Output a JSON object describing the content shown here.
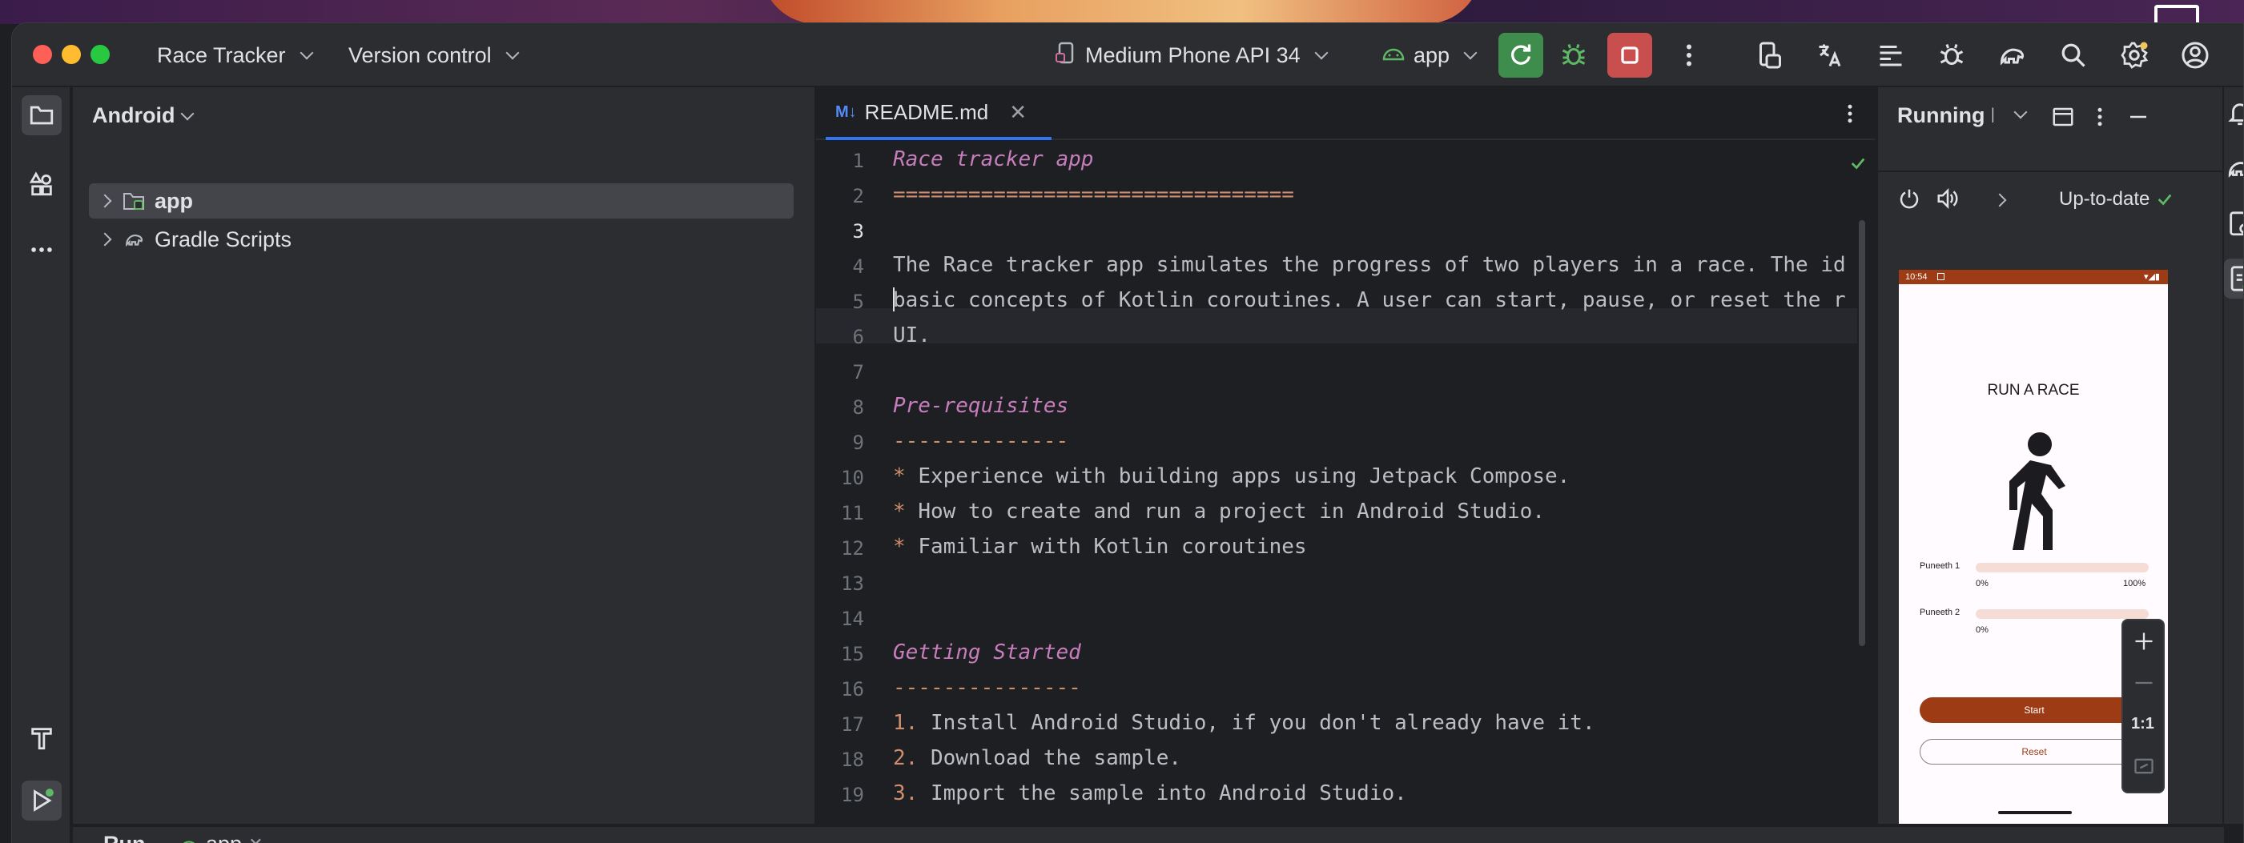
{
  "titlebar": {
    "project_name": "Race Tracker",
    "vcs": "Version control",
    "device": "Medium Phone API 34",
    "run_config": "app"
  },
  "project_panel": {
    "view_mode": "Android",
    "items": [
      {
        "label": "app",
        "selected": true
      },
      {
        "label": "Gradle Scripts",
        "selected": false
      }
    ]
  },
  "editor": {
    "tab_label": "README.md",
    "tab_icon": "M↓",
    "lines": [
      "Race tracker app",
      "================================",
      "",
      "The Race tracker app simulates the progress of two players in a race. The id",
      "basic concepts of Kotlin coroutines. A user can start, pause, or reset the r",
      "UI.",
      "",
      "Pre-requisites",
      "--------------",
      "* Experience with building apps using Jetpack Compose.",
      "* How to create and run a project in Android Studio.",
      "* Familiar with Kotlin coroutines",
      "",
      "",
      "Getting Started",
      "---------------",
      "1. Install Android Studio, if you don't already have it.",
      "2. Download the sample.",
      "3. Import the sample into Android Studio."
    ],
    "line_numbers": [
      "1",
      "2",
      "3",
      "4",
      "5",
      "6",
      "7",
      "8",
      "9",
      "10",
      "11",
      "12",
      "13",
      "14",
      "15",
      "16",
      "17",
      "18",
      "19"
    ]
  },
  "running_devices": {
    "title": "Running Devices",
    "status": "Up-to-date",
    "phone": {
      "time": "10:54",
      "title": "RUN A RACE",
      "player1": "Puneeth 1",
      "player2": "Puneeth 2",
      "progress_start": "0%",
      "progress_end": "100%",
      "player1_progress": 0,
      "player2_progress": 0,
      "start_button": "Start",
      "reset_button": "Reset"
    },
    "zoom_reset": "1:1"
  },
  "bottom": {
    "run_label": "Run",
    "run_config": "app"
  },
  "colors": {
    "accent": "#3574f0",
    "run_green": "#3f8d4d",
    "stop_red": "#c94f4f",
    "phone_primary": "#9c3b14"
  }
}
